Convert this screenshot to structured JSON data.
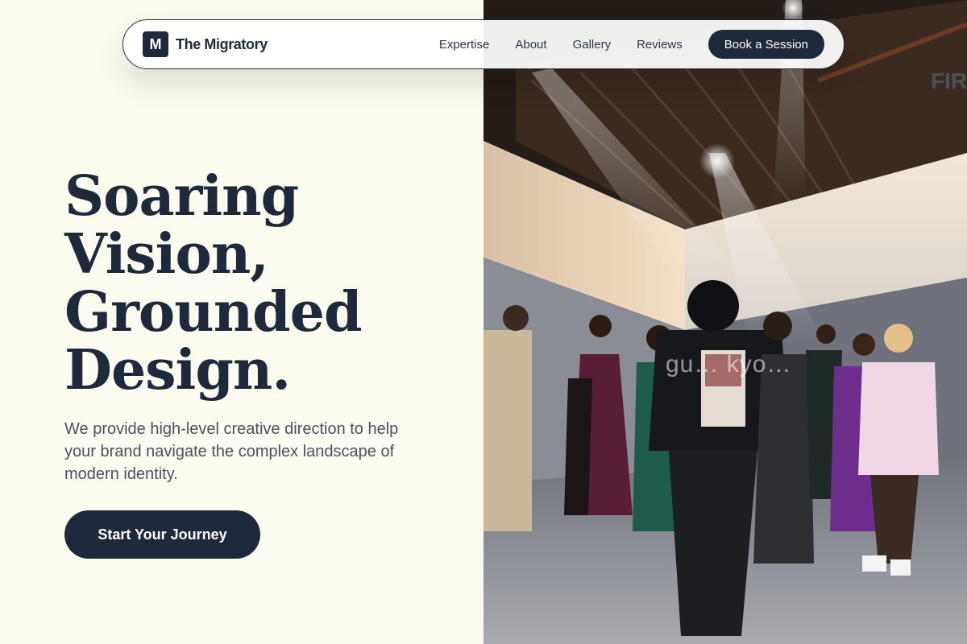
{
  "brand": {
    "mark": "M",
    "name": "The Migratory"
  },
  "nav": {
    "links": [
      "Expertise",
      "About",
      "Gallery",
      "Reviews"
    ],
    "cta": "Book a Session"
  },
  "hero": {
    "headline_lines": [
      "Soaring",
      "Vision,",
      "Grounded",
      "Design."
    ],
    "subtext": "We provide high-level creative direction to help your brand navigate the complex landscape of modern identity.",
    "cta": "Start Your Journey"
  },
  "photo": {
    "watermark": "gu… kyo…",
    "sign_text": "FIR"
  },
  "colors": {
    "background": "#fbfbef",
    "primary": "#1e293b",
    "text_muted": "#4a5160"
  }
}
